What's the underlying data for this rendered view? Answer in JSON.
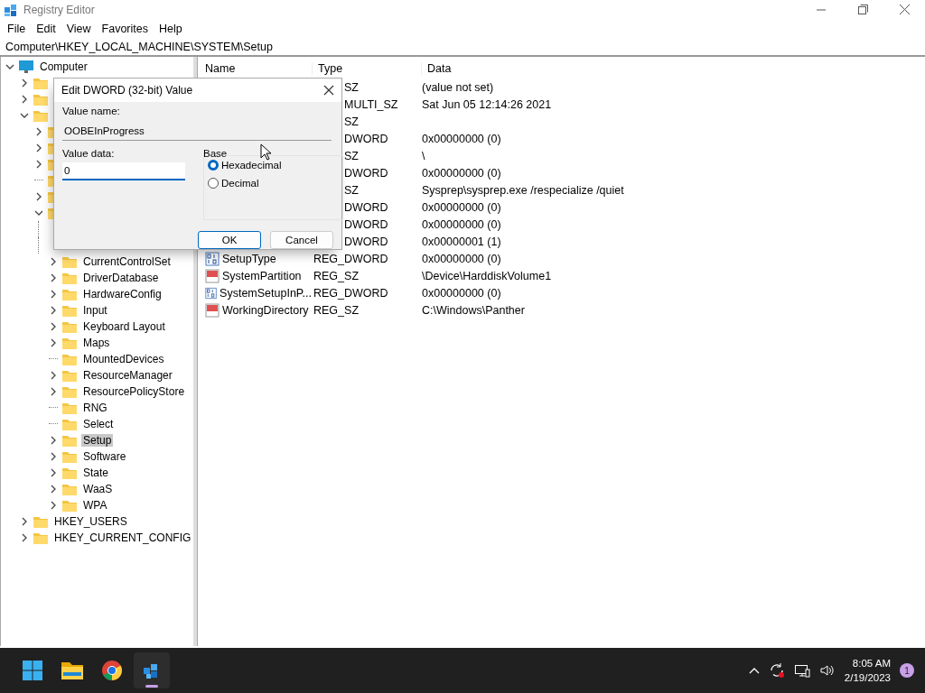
{
  "window": {
    "title": "Registry Editor"
  },
  "menu": [
    "File",
    "Edit",
    "View",
    "Favorites",
    "Help"
  ],
  "address": "Computer\\HKEY_LOCAL_MACHINE\\SYSTEM\\Setup",
  "tree": [
    {
      "label": "Computer",
      "expanded": true,
      "selected": false,
      "children": [
        {
          "expanded": false
        },
        {
          "expanded": false
        },
        {
          "expanded": true,
          "children": [
            {
              "expanded": false
            },
            {
              "expanded": false
            },
            {
              "expanded": false
            },
            {
              "leaf": true
            },
            {
              "expanded": false
            },
            {
              "expanded": true,
              "children": [
                {
                  "kind": "hidden"
                },
                {
                  "kind": "hidden"
                },
                {
                  "label": "CurrentControlSet",
                  "expanded": false,
                  "selected": false
                },
                {
                  "label": "DriverDatabase",
                  "expanded": false,
                  "selected": false
                },
                {
                  "label": "HardwareConfig",
                  "expanded": false,
                  "selected": false
                },
                {
                  "label": "Input",
                  "expanded": false,
                  "selected": false
                },
                {
                  "label": "Keyboard Layout",
                  "expanded": false,
                  "selected": false
                },
                {
                  "label": "Maps",
                  "expanded": false,
                  "selected": false
                },
                {
                  "label": "MountedDevices",
                  "leaf": true,
                  "selected": false
                },
                {
                  "label": "ResourceManager",
                  "expanded": false,
                  "selected": false
                },
                {
                  "label": "ResourcePolicyStore",
                  "expanded": false,
                  "selected": false
                },
                {
                  "label": "RNG",
                  "leaf": true,
                  "selected": false
                },
                {
                  "label": "Select",
                  "leaf": true,
                  "selected": false
                },
                {
                  "label": "Setup",
                  "expanded": false,
                  "selected": true
                },
                {
                  "label": "Software",
                  "expanded": false,
                  "selected": false
                },
                {
                  "label": "State",
                  "expanded": false,
                  "selected": false
                },
                {
                  "label": "WaaS",
                  "expanded": false,
                  "selected": false
                },
                {
                  "label": "WPA",
                  "expanded": false,
                  "selected": false
                }
              ]
            }
          ]
        },
        {
          "label": "HKEY_USERS",
          "expanded": false,
          "selected": false
        },
        {
          "label": "HKEY_CURRENT_CONFIG",
          "expanded": false,
          "selected": false
        }
      ]
    }
  ],
  "table": {
    "columns": [
      "Name",
      "Type",
      "Data"
    ],
    "rows": [
      {
        "type": "SZ",
        "data": "(value not set)"
      },
      {
        "type": "MULTI_SZ",
        "data": "Sat Jun 05 12:14:26 2021"
      },
      {
        "type": "SZ"
      },
      {
        "type": "DWORD",
        "data": "0x00000000 (0)"
      },
      {
        "type": "SZ",
        "data": "\\"
      },
      {
        "type": "DWORD",
        "data": "0x00000000 (0)"
      },
      {
        "type": "SZ",
        "data": "Sysprep\\sysprep.exe /respecialize /quiet"
      },
      {
        "type": "DWORD",
        "data": "0x00000000 (0)"
      },
      {
        "type": "DWORD",
        "data": "0x00000000 (0)"
      },
      {
        "type": "DWORD",
        "data": "0x00000001 (1)"
      },
      {
        "kind": "dword",
        "name": "SetupType",
        "type": "REG_DWORD",
        "data": "0x00000000 (0)"
      },
      {
        "kind": "sz",
        "name": "SystemPartition",
        "type": "REG_SZ",
        "data": "\\Device\\HarddiskVolume1"
      },
      {
        "kind": "dword",
        "name": "SystemSetupInP...",
        "type": "REG_DWORD",
        "data": "0x00000000 (0)"
      },
      {
        "kind": "sz",
        "name": "WorkingDirectory",
        "type": "REG_SZ",
        "data": "C:\\Windows\\Panther"
      }
    ]
  },
  "dialog": {
    "title": "Edit DWORD (32-bit) Value",
    "name_label": "Value name:",
    "name_value": "OOBEInProgress",
    "data_label": "Value data:",
    "data_value": "0",
    "base_label": "Base",
    "bases": [
      {
        "label": "Hexadecimal",
        "selected": true
      },
      {
        "label": "Decimal",
        "selected": false
      }
    ],
    "buttons": [
      {
        "label": "OK",
        "default": true
      },
      {
        "label": "Cancel",
        "default": false
      }
    ]
  },
  "taskbar": {
    "apps": [
      {
        "kind": "start",
        "active": false
      },
      {
        "kind": "folder",
        "active": false
      },
      {
        "kind": "browser",
        "active": false
      },
      {
        "kind": "regedit",
        "active": true
      }
    ],
    "time": "8:05 AM",
    "date": "2/19/2023",
    "notifications": "1"
  }
}
